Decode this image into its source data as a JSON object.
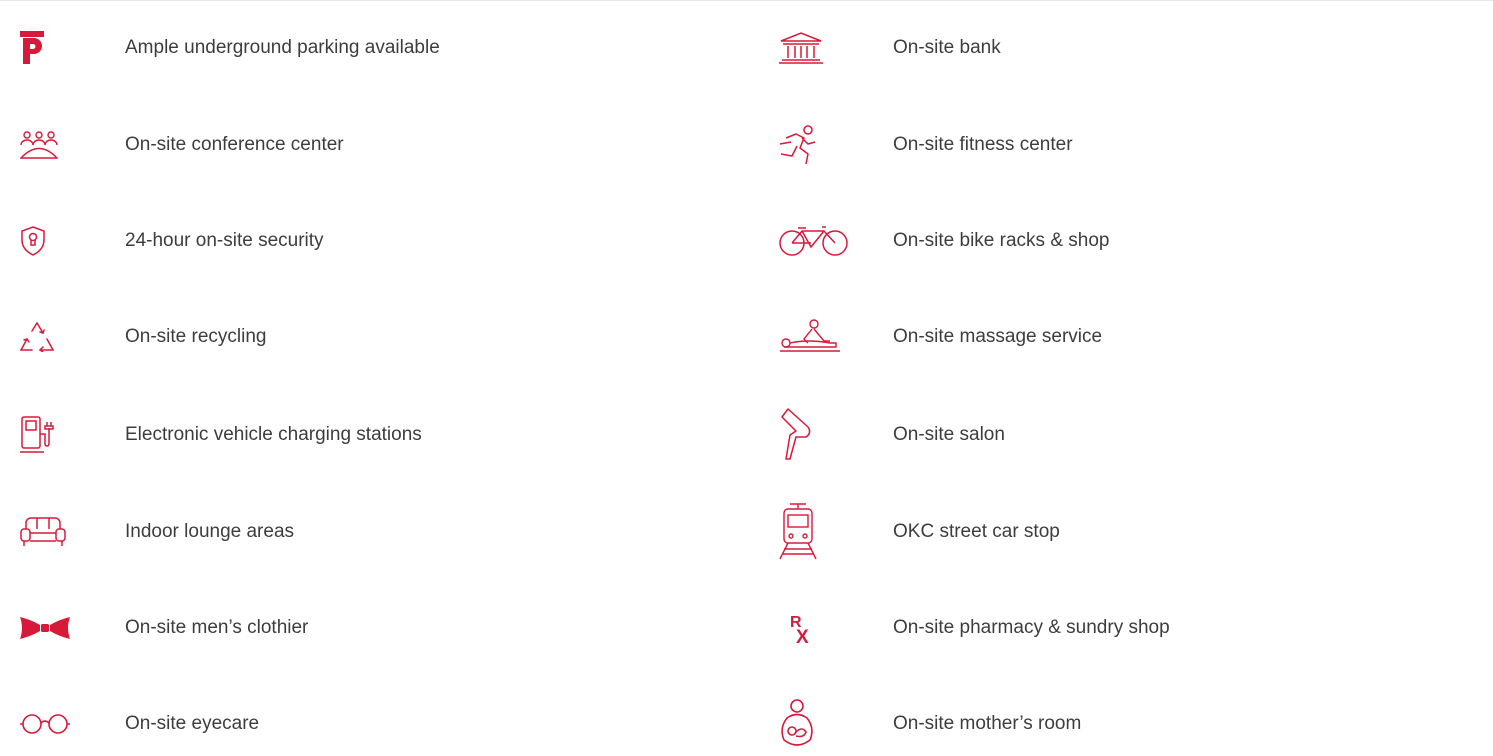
{
  "accent_color": "#d7193a",
  "left_items": [
    {
      "label": "Ample underground parking available",
      "icon": "parking-icon"
    },
    {
      "label": "On-site conference center",
      "icon": "conference-icon"
    },
    {
      "label": "24-hour on-site security",
      "icon": "security-shield-icon"
    },
    {
      "label": "On-site recycling",
      "icon": "recycling-icon"
    },
    {
      "label": "Electronic vehicle charging stations",
      "icon": "ev-charging-icon"
    },
    {
      "label": "Indoor lounge areas",
      "icon": "sofa-icon"
    },
    {
      "label": "On-site men’s clothier",
      "icon": "bow-tie-icon"
    },
    {
      "label": "On-site eyecare",
      "icon": "glasses-icon"
    }
  ],
  "right_items": [
    {
      "label": "On-site bank",
      "icon": "bank-icon"
    },
    {
      "label": "On-site fitness center",
      "icon": "runner-icon"
    },
    {
      "label": "On-site bike racks & shop",
      "icon": "bicycle-icon"
    },
    {
      "label": "On-site massage service",
      "icon": "massage-icon"
    },
    {
      "label": "On-site salon",
      "icon": "hair-dryer-icon"
    },
    {
      "label": "OKC street car stop",
      "icon": "street-car-icon"
    },
    {
      "label": "On-site pharmacy & sundry shop",
      "icon": "pharmacy-rx-icon"
    },
    {
      "label": "On-site mother’s room",
      "icon": "mother-baby-icon"
    }
  ]
}
